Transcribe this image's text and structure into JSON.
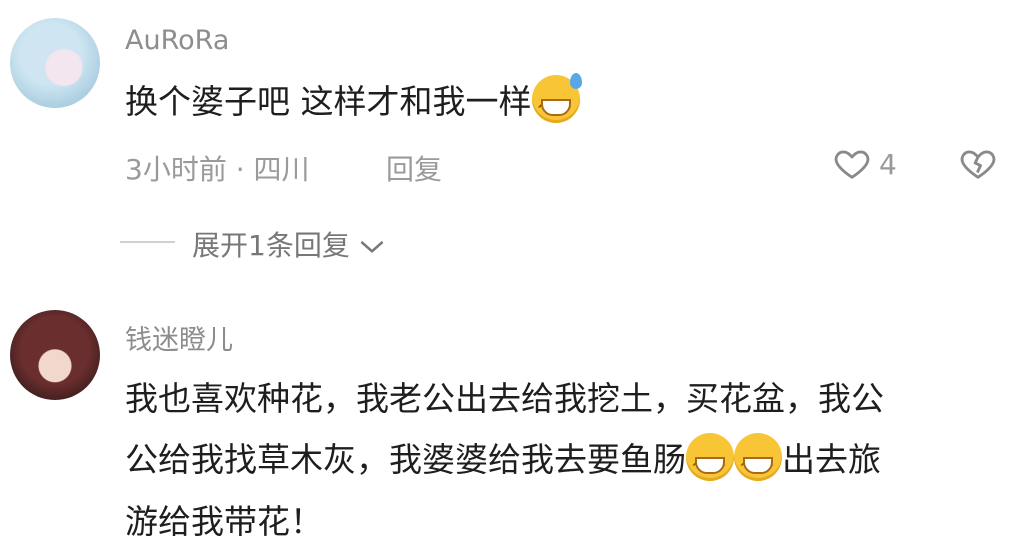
{
  "comments": [
    {
      "username": "AuRoRa",
      "text": "换个婆子吧  这样才和我一样",
      "time_location": "3小时前 · 四川",
      "reply_label": "回复",
      "like_count": "4",
      "expand_label": "展开1条回复"
    },
    {
      "username": "钱迷瞪儿",
      "text_line1": "我也喜欢种花，我老公出去给我挖土，买花盆，我公",
      "text_line2a": "公给我找草木灰，我婆婆给我去要鱼肠",
      "text_line2b": "出去旅",
      "text_line3": "游给我带花！"
    }
  ],
  "icons": [
    "heart-outline-icon",
    "broken-heart-icon",
    "chevron-down-icon",
    "grinning-sweat-emoji",
    "grinning-emoji"
  ]
}
